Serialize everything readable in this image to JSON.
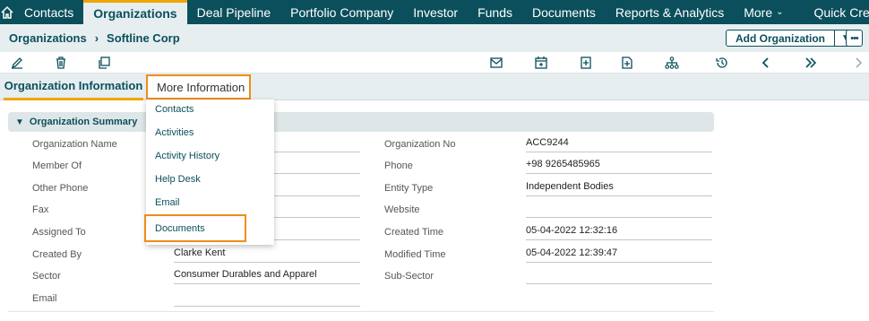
{
  "nav": {
    "items": [
      "Contacts",
      "Organizations",
      "Deal Pipeline",
      "Portfolio Company",
      "Investor",
      "Funds",
      "Documents",
      "Reports & Analytics",
      "More",
      "Quick Create"
    ],
    "active": "Organizations"
  },
  "breadcrumb": {
    "module": "Organizations",
    "record": "Softline Corp"
  },
  "header": {
    "add_button": "Add Organization"
  },
  "tabs": {
    "info": "Organization Information",
    "more": "More Information"
  },
  "section": {
    "title": "Organization Summary"
  },
  "dropdown": {
    "items": [
      "Contacts",
      "Activities",
      "Activity History",
      "Help Desk",
      "Email",
      "Documents"
    ]
  },
  "fields": {
    "left": [
      {
        "label": "Organization Name",
        "value": ""
      },
      {
        "label": "Member Of",
        "value": ""
      },
      {
        "label": "Other Phone",
        "value": ""
      },
      {
        "label": "Fax",
        "value": ""
      },
      {
        "label": "Assigned To",
        "value": ""
      },
      {
        "label": "Created By",
        "value": "Clarke Kent"
      },
      {
        "label": "Sector",
        "value": "Consumer Durables and Apparel"
      },
      {
        "label": "Email",
        "value": ""
      }
    ],
    "right": [
      {
        "label": "Organization No",
        "value": "ACC9244"
      },
      {
        "label": "Phone",
        "value": "+98 9265485965"
      },
      {
        "label": "Entity Type",
        "value": "Independent Bodies"
      },
      {
        "label": "Website",
        "value": ""
      },
      {
        "label": "Created Time",
        "value": "05-04-2022 12:32:16"
      },
      {
        "label": "Modified Time",
        "value": "05-04-2022 12:39:47"
      },
      {
        "label": "Sub-Sector",
        "value": ""
      }
    ]
  },
  "colors": {
    "primary": "#0b4f5c",
    "accent": "#f0a500",
    "highlight": "#f08c1a"
  }
}
